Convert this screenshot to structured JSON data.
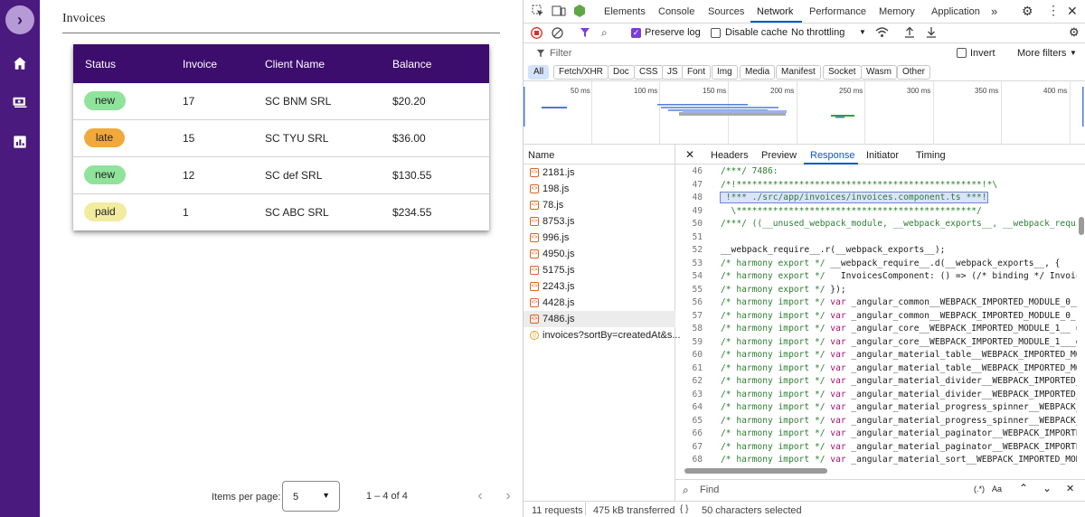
{
  "app": {
    "title": "Invoices",
    "table": {
      "headers": [
        "Status",
        "Invoice",
        "Client Name",
        "Balance"
      ],
      "rows": [
        {
          "status": "new",
          "status_color": "#8fe39a",
          "invoice": "17",
          "client": "SC BNM SRL",
          "balance": "$20.20"
        },
        {
          "status": "late",
          "status_color": "#f1a93c",
          "invoice": "15",
          "client": "SC TYU SRL",
          "balance": "$36.00"
        },
        {
          "status": "new",
          "status_color": "#8fe39a",
          "invoice": "12",
          "client": "SC def SRL",
          "balance": "$130.55"
        },
        {
          "status": "paid",
          "status_color": "#f1eca0",
          "invoice": "1",
          "client": "SC ABC SRL",
          "balance": "$234.55"
        }
      ]
    },
    "paginator": {
      "items_label": "Items per page:",
      "page_size": "5",
      "range": "1 – 4 of 4"
    },
    "colors": {
      "rail": "#4a1a7e",
      "header": "#3d0d6e"
    }
  },
  "devtools": {
    "tabs": [
      "Elements",
      "Console",
      "Sources",
      "Network",
      "Performance",
      "Memory",
      "Application"
    ],
    "active_tab": "Network",
    "toolbar": {
      "preserve_log": "Preserve log",
      "disable_cache": "Disable cache",
      "throttling": "No throttling"
    },
    "filter": {
      "placeholder": "Filter",
      "invert": "Invert",
      "more_filters": "More filters"
    },
    "type_filters": [
      "All",
      "Fetch/XHR",
      "Doc",
      "CSS",
      "JS",
      "Font",
      "Img",
      "Media",
      "Manifest",
      "Socket",
      "Wasm",
      "Other"
    ],
    "timeline_ticks": [
      "50 ms",
      "100 ms",
      "150 ms",
      "200 ms",
      "250 ms",
      "300 ms",
      "350 ms",
      "400 ms"
    ],
    "name_header": "Name",
    "requests": [
      "2181.js",
      "198.js",
      "78.js",
      "8753.js",
      "996.js",
      "4950.js",
      "5175.js",
      "2243.js",
      "4428.js",
      "7486.js",
      "invoices?sortBy=createdAt&s..."
    ],
    "detail_tabs": [
      "Headers",
      "Preview",
      "Response",
      "Initiator",
      "Timing"
    ],
    "active_detail_tab": "Response",
    "code_lines": [
      {
        "n": "46",
        "t": "/***/ 7486:"
      },
      {
        "n": "47",
        "t": "/*!***********************************************!*\\"
      },
      {
        "n": "48",
        "t": " !*** ./src/app/invoices/invoices.component.ts ***!"
      },
      {
        "n": "49",
        "t": "  \\**********************************************/"
      },
      {
        "n": "50",
        "t": "/***/ ((__unused_webpack_module, __webpack_exports__, __webpack_requi"
      },
      {
        "n": "51",
        "t": ""
      },
      {
        "n": "52",
        "t": "__webpack_require__.r(__webpack_exports__);"
      },
      {
        "n": "53",
        "t": "/* harmony export */ __webpack_require__.d(__webpack_exports__, {"
      },
      {
        "n": "54",
        "t": "/* harmony export */   InvoicesComponent: () => (/* binding */ Invoic"
      },
      {
        "n": "55",
        "t": "/* harmony export */ });"
      },
      {
        "n": "56",
        "t": "/* harmony import */ var _angular_common__WEBPACK_IMPORTED_MODULE_0__"
      },
      {
        "n": "57",
        "t": "/* harmony import */ var _angular_common__WEBPACK_IMPORTED_MODULE_0_"
      },
      {
        "n": "58",
        "t": "/* harmony import */ var _angular_core__WEBPACK_IMPORTED_MODULE_1__ ="
      },
      {
        "n": "59",
        "t": "/* harmony import */ var _angular_core__WEBPACK_IMPORTED_MODULE_1___d"
      },
      {
        "n": "60",
        "t": "/* harmony import */ var _angular_material_table__WEBPACK_IMPORTED_MO"
      },
      {
        "n": "61",
        "t": "/* harmony import */ var _angular_material_table__WEBPACK_IMPORTED_MO"
      },
      {
        "n": "62",
        "t": "/* harmony import */ var _angular_material_divider__WEBPACK_IMPORTED_"
      },
      {
        "n": "63",
        "t": "/* harmony import */ var _angular_material_divider__WEBPACK_IMPORTED_"
      },
      {
        "n": "64",
        "t": "/* harmony import */ var _angular_material_progress_spinner__WEBPACK_"
      },
      {
        "n": "65",
        "t": "/* harmony import */ var _angular_material_progress_spinner__WEBPACK_"
      },
      {
        "n": "66",
        "t": "/* harmony import */ var _angular_material_paginator__WEBPACK_IMPORTE"
      },
      {
        "n": "67",
        "t": "/* harmony import */ var _angular_material_paginator__WEBPACK_IMPORTE"
      },
      {
        "n": "68",
        "t": "/* harmony import */ var _angular_material_sort__WEBPACK_IMPORTED_MOD"
      }
    ],
    "find": {
      "placeholder": "Find",
      "regex": "(.*)",
      "case": "Aa"
    },
    "status": {
      "requests": "11 requests",
      "transferred": "475 kB transferred",
      "selection": "50 characters selected"
    }
  }
}
